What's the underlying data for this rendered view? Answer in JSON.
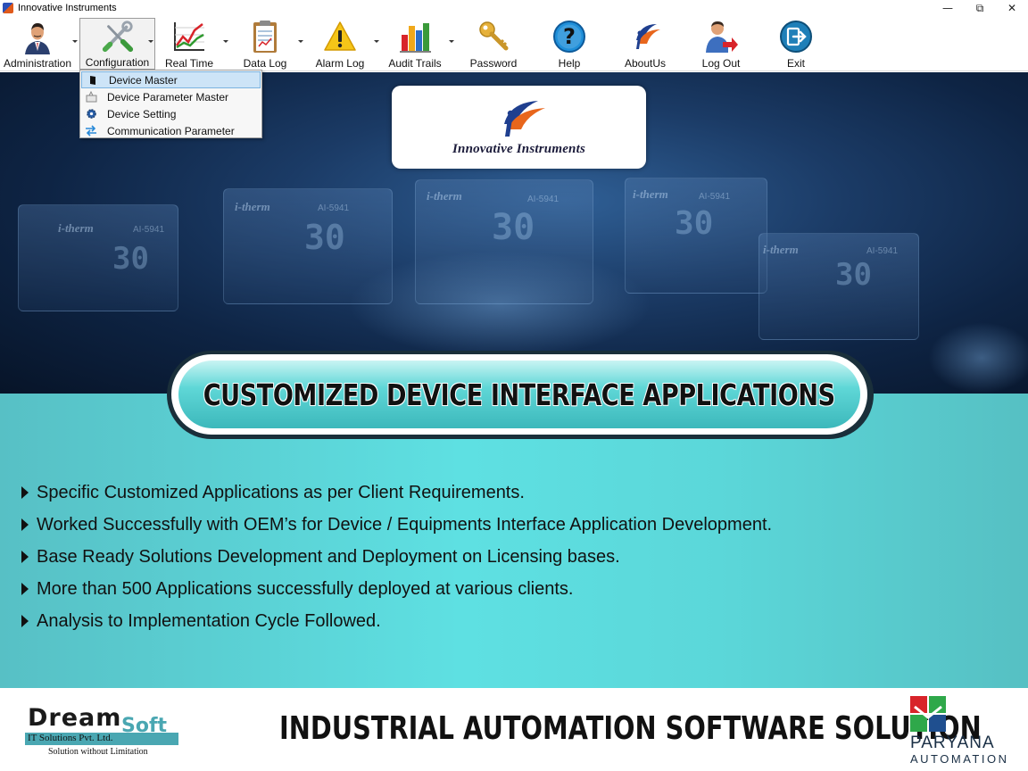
{
  "window": {
    "title": "Innovative Instruments",
    "controls": {
      "minimize": "—",
      "restore": "⧉",
      "close": "✕"
    }
  },
  "toolbar": {
    "items": [
      {
        "label": "Administration",
        "icon": "administrator-icon",
        "has_menu": true
      },
      {
        "label": "Configuration",
        "icon": "tools-icon",
        "has_menu": true,
        "active": true
      },
      {
        "label": "Real Time",
        "icon": "realtime-chart-icon",
        "has_menu": true
      },
      {
        "label": "Data Log",
        "icon": "clipboard-icon",
        "has_menu": true
      },
      {
        "label": "Alarm Log",
        "icon": "warning-icon",
        "has_menu": true
      },
      {
        "label": "Audit Trails",
        "icon": "bar-chart-icon",
        "has_menu": true
      },
      {
        "label": "Password",
        "icon": "key-icon",
        "has_menu": false
      },
      {
        "label": "Help",
        "icon": "help-icon",
        "has_menu": false
      },
      {
        "label": "AboutUs",
        "icon": "brand-logo-icon",
        "has_menu": false
      },
      {
        "label": "Log Out",
        "icon": "logout-user-icon",
        "has_menu": false
      },
      {
        "label": "Exit",
        "icon": "exit-icon",
        "has_menu": false
      }
    ]
  },
  "configuration_menu": {
    "items": [
      {
        "label": "Device Master",
        "icon": "device-icon",
        "selected": true
      },
      {
        "label": "Device Parameter Master",
        "icon": "parameter-icon",
        "selected": false
      },
      {
        "label": "Device Setting",
        "icon": "gear-icon",
        "selected": false
      },
      {
        "label": "Communication Parameter",
        "icon": "swap-arrows-icon",
        "selected": false
      }
    ]
  },
  "hero": {
    "logo_text": "Innovative Instruments",
    "devices": [
      {
        "brand": "i-therm",
        "model": "AI-5941",
        "reading": "30"
      },
      {
        "brand": "i-therm",
        "model": "AI-5941",
        "reading": "30"
      },
      {
        "brand": "i-therm",
        "model": "AI-5941",
        "reading": "30"
      },
      {
        "brand": "i-therm",
        "model": "AI-5941",
        "reading": "30"
      },
      {
        "brand": "i-therm",
        "model": "AI-5941",
        "reading": "30"
      }
    ]
  },
  "banner": {
    "text": "CUSTOMIZED DEVICE INTERFACE APPLICATIONS"
  },
  "features": [
    "Specific Customized Applications as per Client Requirements.",
    "Worked Successfully with OEM’s for Device / Equipments Interface Application Development.",
    "Base Ready Solutions Development and Deployment on Licensing bases.",
    "More than 500 Applications successfully deployed at various clients.",
    "Analysis to Implementation Cycle Followed."
  ],
  "footer": {
    "dreamsoft": {
      "dream": "Dream",
      "soft": "Soft",
      "company": "IT Solutions Pvt. Ltd.",
      "tagline": "Solution without Limitation"
    },
    "title": "INDUSTRIAL AUTOMATION SOFTWARE SOLUTION",
    "paryana": {
      "name": "PARYANA",
      "sub": "AUTOMATION"
    }
  },
  "colors": {
    "teal": "#5ee0e2",
    "hero_dark": "#0e2444",
    "menu_highlight": "#cde4f7",
    "brand_orange": "#e8661c",
    "brand_blue": "#1f3f8f"
  }
}
